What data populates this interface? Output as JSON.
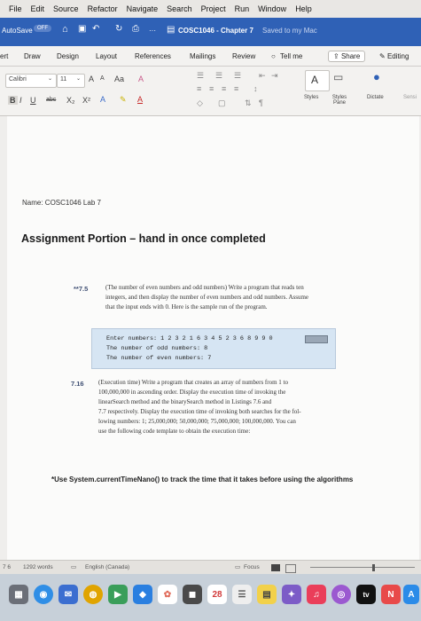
{
  "menubar": {
    "items": [
      "File",
      "Edit",
      "Source",
      "Refactor",
      "Navigate",
      "Search",
      "Project",
      "Run",
      "Window",
      "Help"
    ]
  },
  "titlebar": {
    "autosave_label": "AutoSave",
    "autosave_state": "OFF",
    "doc_title": "COSC1046 - Chapter 7",
    "save_status": "Saved to my Mac",
    "ellipsis": "···"
  },
  "ribbon": {
    "tabs": [
      "ert",
      "Draw",
      "Design",
      "Layout",
      "References",
      "Mailings",
      "Review"
    ],
    "tell_me": "Tell me",
    "share": "Share",
    "editing": "Editing",
    "font_name": "Calibri",
    "font_size": "11",
    "bold": "B",
    "italic": "I",
    "underline": "U",
    "strike": "abc",
    "subscript": "X₂",
    "superscript": "X²",
    "grow_font": "A",
    "shrink_font": "A",
    "change_case": "Aa",
    "clear_format": "A",
    "styles_label": "Styles",
    "styles_pane_label": "Styles Pane",
    "dictate_label": "Dictate",
    "sensitivity_label": "Sensi"
  },
  "document": {
    "name_line": "Name: COSC1046 Lab 7",
    "heading": "Assignment Portion – hand in once completed",
    "ex1_number": "**7.5",
    "ex1_lines": [
      "(The number of even numbers and odd numbers) Write a program that reads ten",
      "integers, and then display the number of even numbers and odd numbers. Assume",
      "that the input ends with 0. Here is the sample run of the program."
    ],
    "console_lines": [
      "Enter numbers: 1 2 3 2 1 6 3 4 5 2 3 6 8 9 9 0",
      "The number of odd numbers: 8",
      "The number of even numbers: 7"
    ],
    "ex2_number": "7.16",
    "ex2_lines": [
      "(Execution time) Write a program that creates an array of numbers from 1 to",
      "100,000,000 in ascending order. Display the execution time of invoking the",
      "linearSearch method and the binarySearch method in Listings 7.6 and",
      "7.7 respectively. Display the execution time of invoking both searches for the fol-",
      "lowing numbers: 1; 25,000,000; 50,000,000; 75,000,000; 100,000,000. You can",
      "use the following code template to obtain the execution time:"
    ],
    "note": "*Use System.currentTimeNano() to track the time that it takes before using the algorithms"
  },
  "statusbar": {
    "page": "7 6",
    "words": "1292 words",
    "language": "English (Canada)",
    "focus": "Focus"
  },
  "dock": {
    "calendar_day": "28",
    "tv_label": "tv"
  },
  "colors": {
    "titlebar": "#2f61b6",
    "console_bg": "#d6e5f3",
    "exercise_number": "#3f4f73"
  }
}
